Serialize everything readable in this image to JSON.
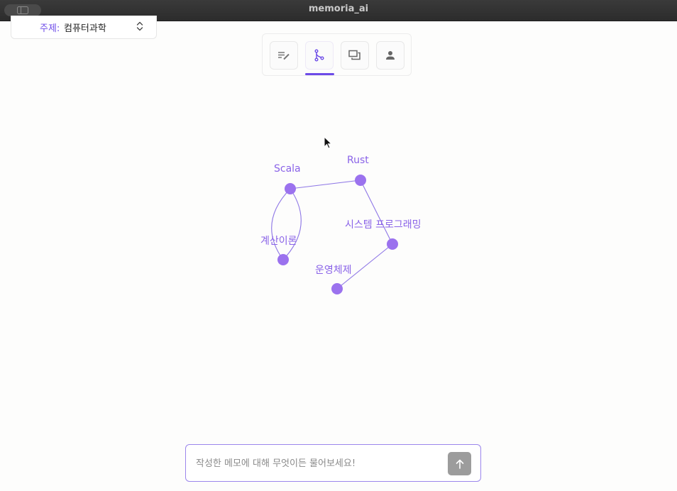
{
  "window": {
    "title": "memoria_ai"
  },
  "topic": {
    "label": "주제:",
    "value": "컴퓨터과학"
  },
  "tabs": [
    {
      "name": "notes",
      "icon": "edit-notes-icon",
      "active": false
    },
    {
      "name": "graph",
      "icon": "branch-graph-icon",
      "active": true
    },
    {
      "name": "chat",
      "icon": "chat-bubbles-icon",
      "active": false
    },
    {
      "name": "profile",
      "icon": "person-icon",
      "active": false
    }
  ],
  "graph": {
    "nodes": [
      {
        "id": "scala",
        "label": "Scala"
      },
      {
        "id": "rust",
        "label": "Rust"
      },
      {
        "id": "systems",
        "label": "시스템 프로그래밍"
      },
      {
        "id": "computation",
        "label": "계산이론"
      },
      {
        "id": "os",
        "label": "운영체제"
      }
    ],
    "edges": [
      {
        "from": "scala",
        "to": "rust"
      },
      {
        "from": "rust",
        "to": "systems"
      },
      {
        "from": "systems",
        "to": "os"
      },
      {
        "from": "scala",
        "to": "computation"
      },
      {
        "from": "computation",
        "to": "scala"
      }
    ]
  },
  "chat": {
    "placeholder": "작성한 메모에 대해 무엇이든 물어보세요!",
    "send_icon": "arrow-up-icon"
  },
  "colors": {
    "accent": "#6d4be8",
    "node": "#9b72ee",
    "edge": "#8f78e6"
  }
}
